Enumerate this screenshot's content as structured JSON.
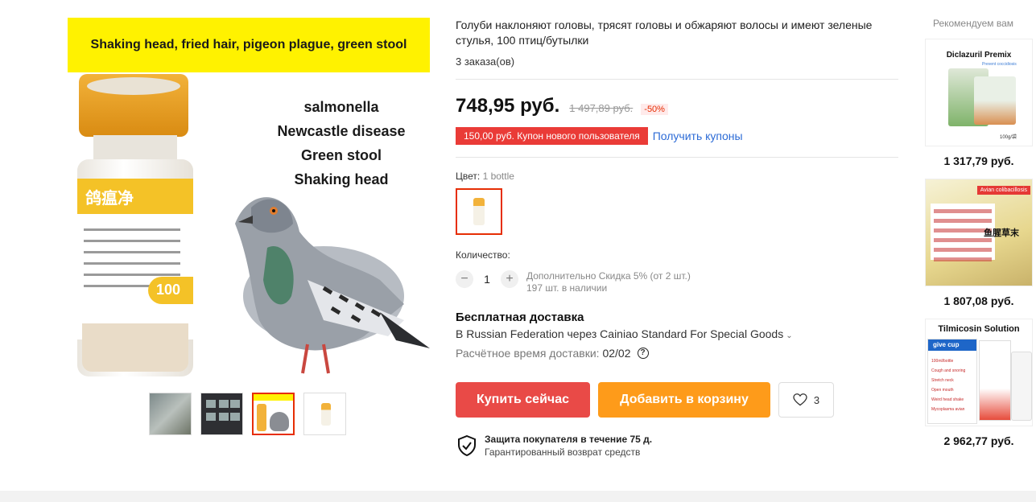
{
  "gallery": {
    "banner_text": "Shaking head, fried hair, pigeon plague, green stool",
    "diseases": [
      "salmonella",
      "Newcastle disease",
      "Green stool",
      "Shaking head"
    ],
    "vial_label": "鸽瘟净",
    "vial_number": "100",
    "thumbnails": [
      "pigeon-photo",
      "collage",
      "product-main",
      "vial-only"
    ],
    "active_thumbnail": 3
  },
  "product": {
    "title": "Голуби наклоняют головы, трясят головы и обжаряют волосы и имеют зеленые стулья, 100 птиц/бутылки",
    "orders": "3 заказа(ов)",
    "price": "748,95 руб.",
    "old_price": "1 497,89 руб.",
    "discount": "-50%",
    "coupon_text": "150,00 руб. Купон нового пользователя",
    "get_coupons": "Получить купоны",
    "color_label": "Цвет:",
    "color_value": "1 bottle",
    "quantity_label": "Количество:",
    "quantity": "1",
    "quantity_minus": "−",
    "quantity_plus": "+",
    "qty_discount": "Дополнительно Скидка 5% (от 2 шт.)",
    "qty_stock": "197 шт. в наличии"
  },
  "shipping": {
    "title": "Бесплатная доставка",
    "via": "В Russian Federation через Cainiao Standard For Special Goods",
    "eta_label": "Расчётное время доставки:",
    "eta_value": "02/02",
    "help": "?"
  },
  "actions": {
    "buy_now": "Купить сейчас",
    "add_to_cart": "Добавить в корзину",
    "wishlist_count": "3"
  },
  "protection": {
    "title": "Защита покупателя в течение 75 д.",
    "subtitle": "Гарантированный возврат средств"
  },
  "recommended": {
    "title": "Рекомендуем вам",
    "items": [
      {
        "image_title": "Diclazuril Premix",
        "image_sub": "Prevent coccidiosis",
        "image_note": "100g/袋",
        "price": "1 317,79 руб."
      },
      {
        "image_tag": "Avian colibacillosis",
        "image_title": "鱼腥草末",
        "price": "1 807,08 руб."
      },
      {
        "image_title": "Tilmicosin Solution",
        "image_badge": "give cup",
        "image_lines": [
          "100ml/bottle",
          "Cough and snoring",
          "Stretch neck",
          "Open mouth",
          "Weird head shake",
          "Mycoplasma avian"
        ],
        "price": "2 962,77 руб."
      }
    ]
  },
  "colors": {
    "accent_red": "#e62e04",
    "buy_button": "#e94a47",
    "cart_button": "#fe9b1a",
    "coupon_bg": "#ea3b37",
    "link_blue": "#2c6bd6",
    "banner_yellow": "#fff200"
  }
}
